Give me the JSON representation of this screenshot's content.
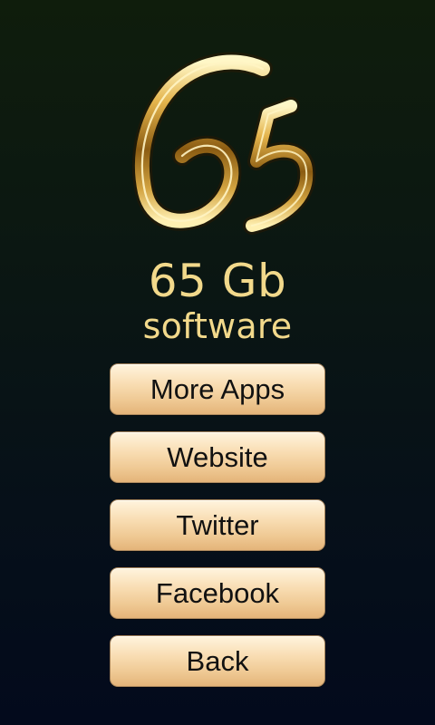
{
  "brand": {
    "logo_icon": "gold-65-monogram-icon",
    "line1": "65 Gb",
    "line2": "software",
    "text_color": "#f2d98b"
  },
  "menu": {
    "buttons": [
      {
        "label": "More Apps"
      },
      {
        "label": "Website"
      },
      {
        "label": "Twitter"
      },
      {
        "label": "Facebook"
      },
      {
        "label": "Back"
      }
    ],
    "button_gradient_top": "#fff4de",
    "button_gradient_bottom": "#e4b479",
    "button_text_color": "#111111"
  },
  "background": {
    "top": "#0f1d0c",
    "bottom": "#030a1c"
  }
}
